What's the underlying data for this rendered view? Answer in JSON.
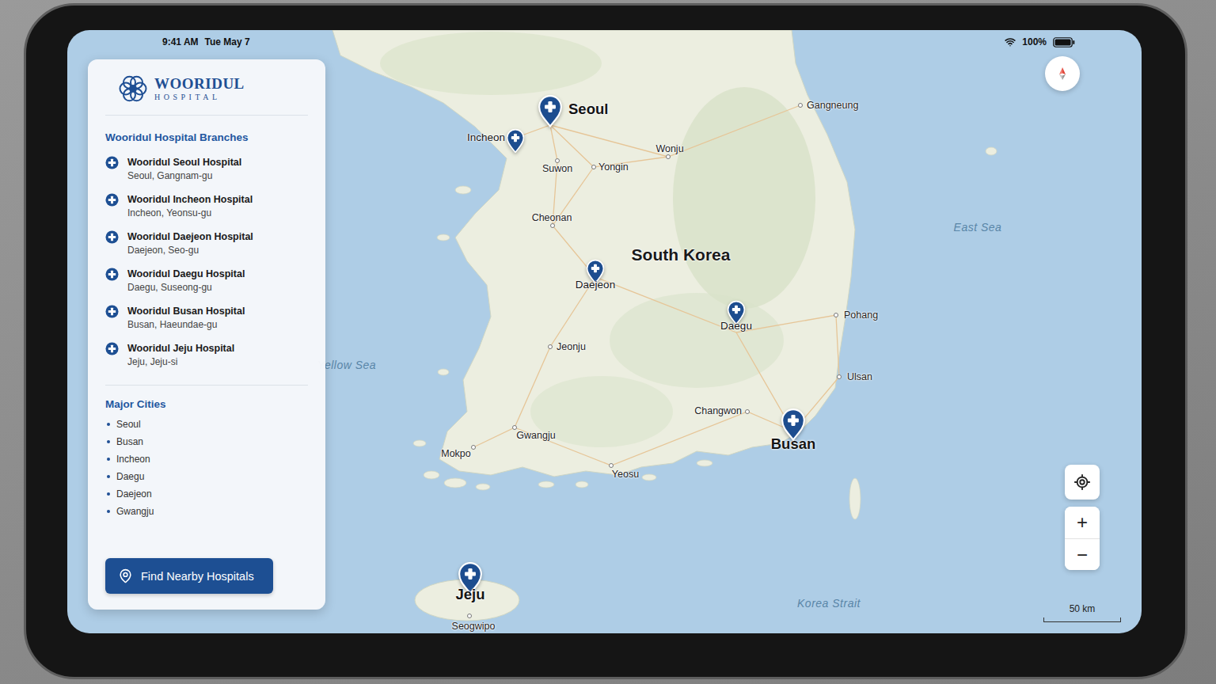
{
  "status_bar": {
    "time": "9:41 AM",
    "date": "Tue May 7",
    "battery": "100%"
  },
  "logo": {
    "name": "WOORIDUL",
    "subtitle": "HOSPITAL"
  },
  "sidebar": {
    "branches_title": "Wooridul Hospital Branches",
    "branches": [
      {
        "name": "Wooridul Seoul Hospital",
        "address": "Seoul, Gangnam-gu"
      },
      {
        "name": "Wooridul Incheon Hospital",
        "address": "Incheon, Yeonsu-gu"
      },
      {
        "name": "Wooridul Daejeon Hospital",
        "address": "Daejeon, Seo-gu"
      },
      {
        "name": "Wooridul Daegu Hospital",
        "address": "Daegu, Suseong-gu"
      },
      {
        "name": "Wooridul Busan Hospital",
        "address": "Busan, Haeundae-gu"
      },
      {
        "name": "Wooridul Jeju Hospital",
        "address": "Jeju, Jeju-si"
      }
    ],
    "cities_title": "Major Cities",
    "cities": [
      "Seoul",
      "Busan",
      "Incheon",
      "Daegu",
      "Daejeon",
      "Gwangju"
    ],
    "button": "Find Nearby Hospitals"
  },
  "map": {
    "country": "South Korea",
    "seas": [
      "Yellow Sea",
      "East Sea",
      "Korea Strait"
    ],
    "pins": [
      {
        "label": "Seoul",
        "kind": "major"
      },
      {
        "label": "Incheon",
        "kind": "minor"
      },
      {
        "label": "Daejeon",
        "kind": "minor"
      },
      {
        "label": "Daegu",
        "kind": "minor"
      },
      {
        "label": "Busan",
        "kind": "major"
      },
      {
        "label": "Jeju",
        "kind": "major"
      }
    ],
    "cities": [
      "Gangneung",
      "Wonju",
      "Suwon",
      "Yongin",
      "Cheonan",
      "Pohang",
      "Jeonju",
      "Ulsan",
      "Changwon",
      "Gwangju",
      "Mokpo",
      "Yeosu",
      "Seogwipo"
    ],
    "zoom": {
      "in": "+",
      "out": "−"
    },
    "scale": "50 km"
  }
}
